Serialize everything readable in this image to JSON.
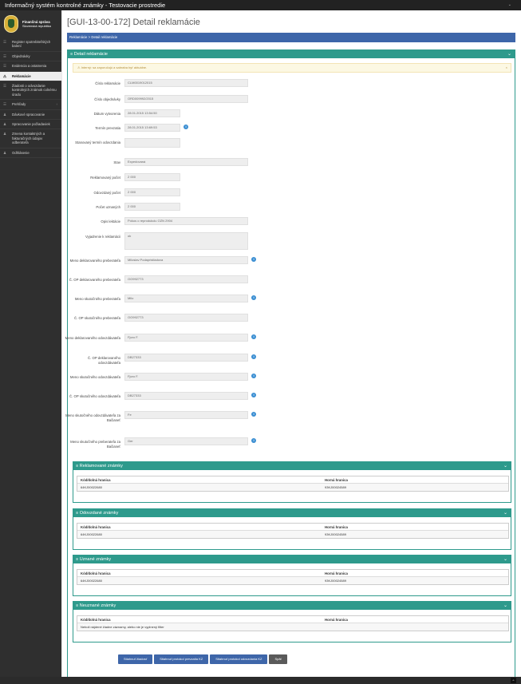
{
  "app": {
    "title": "Informačný systém kontrolné známky - Testovacie prostredie",
    "caret": "⌄"
  },
  "sidebar": {
    "logo_line1": "Finančná správa",
    "logo_line2": "Slovenská republika",
    "items": [
      {
        "label": "Register spotrebiteľských balení",
        "icon": "list-icon"
      },
      {
        "label": "Objednávky",
        "icon": "list-icon"
      },
      {
        "label": "Evidencia a ostatnenia",
        "icon": "list-icon"
      },
      {
        "label": "Reklamácie",
        "icon": "warning-icon",
        "active": true
      },
      {
        "label": "Žiadosti o odvozdanie kontrolných známok colnému úradu",
        "icon": "list-icon"
      },
      {
        "label": "Prehľady",
        "icon": "list-icon",
        "arrow": "‹"
      },
      {
        "label": "Dávkové spracovanie",
        "icon": "user-icon"
      },
      {
        "label": "Spracovanie požiadaviek",
        "icon": "user-icon"
      },
      {
        "label": "Zmena kontaktných a fakturačných údajov odberateľa",
        "icon": "user-icon"
      },
      {
        "label": "Odhlásenie",
        "icon": "user-icon"
      }
    ]
  },
  "page": {
    "title": "[GUI-13-00-172] Detail reklamácie",
    "breadcrumb": "Reklamácie  >  Detail reklamácie"
  },
  "detail": {
    "heading": "≡ Detail reklamácie",
    "alert": "⚠ Interný: sa zaporučujú a sabraba byť aktuálne.",
    "fields": [
      {
        "label": "Číslo reklamácie",
        "value": "CLM0019012015"
      },
      {
        "label": "Číslo objednávky",
        "value": "ORD009992/2015"
      },
      {
        "label": "Dátum vytvorenia",
        "value": "28.01.2015 13:54:50"
      },
      {
        "label": "Termín prevzatia",
        "value": "28.01.2015 13:69:53",
        "info": true
      },
      {
        "label": "Stanovaný termín odovzdania",
        "value": ""
      },
      {
        "label": "Stav",
        "value": "Expedovaná"
      },
      {
        "label": "Reklamovaný počet",
        "value": "2 000"
      },
      {
        "label": "Odovzdaný počet",
        "value": "2 000"
      },
      {
        "label": "Počet uznaných",
        "value": "2 000"
      },
      {
        "label": "Opis lektácie",
        "value": "Pokus o reprodukciu OZN 2904"
      },
      {
        "label": "Vyjadrenie k reklamácii",
        "value": "ok"
      },
      {
        "label": "Meno deklarovaného preberateľa",
        "value": "Miloslav Podapristladova",
        "info": true
      },
      {
        "label": "Č. OP deklarovaného preberateľa",
        "value": "OO992773"
      },
      {
        "label": "Meno skutočného preberateľa",
        "value": "Milo",
        "info": true
      },
      {
        "label": "Č. OP skutočného preberateľa",
        "value": "OO992773"
      },
      {
        "label": "Meno deklarovaného odovzdávateľa",
        "value": "Fjoro F.",
        "info": true
      },
      {
        "label": "Č. OP deklarovaného odovzdávateľa",
        "value": "DB27333",
        "info": true
      },
      {
        "label": "Meno skutočného odovzdávateľa",
        "value": "Fjoro F.",
        "info": true
      },
      {
        "label": "Č. OP skutočného odovzdávateľa",
        "value": "DB27333",
        "info": true
      },
      {
        "label": "Meno skutočného odovzdávateľa za Bačianeť",
        "value": "Fe",
        "info": true
      },
      {
        "label": "Meno skutočného preberateľa za Bačianeť",
        "value": "Ger",
        "info": true
      }
    ]
  },
  "tables": {
    "col1": "Kód/dolná hranica",
    "col2": "Horná hranica",
    "reklamovane": {
      "heading": "≡ Reklamované známky",
      "c1": "64KJ00022680",
      "c2": "93KJ00024589"
    },
    "odovzdane": {
      "heading": "≡ Odovzdané známky",
      "c1": "64KJ00022680",
      "c2": "93KJ00024589"
    },
    "uznane": {
      "heading": "≡ Uznané známky",
      "c1": "64KJ00022680",
      "c2": "93KJ00024589"
    },
    "neuznane": {
      "heading": "≡ Neuznané známky",
      "empty": "Neboli nájdené žiadne záznamy, alebo nie je vyplnený filter"
    }
  },
  "buttons": {
    "download_request": "Stiahnuť žiadosť",
    "download_protocol_takeover": "Stiahnuť protokol prevzatia KZ",
    "download_protocol_handover": "Stiahnuť protokol odovzdania KZ",
    "back": "Späť"
  },
  "icons": {
    "chevron": "⌄",
    "info": "i",
    "close": "×",
    "up": "^"
  },
  "colors": {
    "panel": "#2e9a8c",
    "breadcrumb": "#3e66a9",
    "sidebar": "#2f2f2f"
  }
}
